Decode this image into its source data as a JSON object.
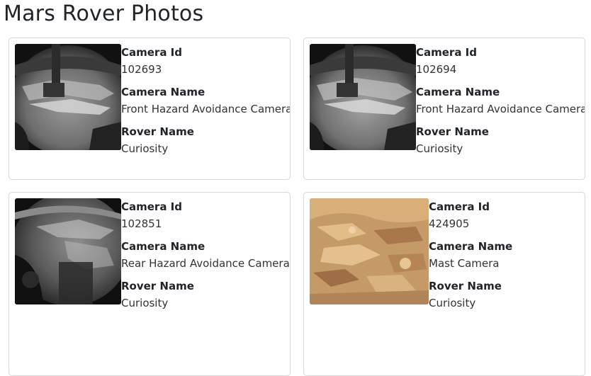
{
  "page": {
    "title": "Mars Rover Photos"
  },
  "labels": {
    "camera_id": "Camera Id",
    "camera_name": "Camera Name",
    "rover_name": "Rover Name"
  },
  "photos": [
    {
      "camera_id": "102693",
      "camera_name": "Front Hazard Avoidance Camera",
      "rover_name": "Curiosity",
      "image_kind": "grayscale-fisheye-hazcam"
    },
    {
      "camera_id": "102694",
      "camera_name": "Front Hazard Avoidance Camera",
      "rover_name": "Curiosity",
      "image_kind": "grayscale-fisheye-hazcam"
    },
    {
      "camera_id": "102851",
      "camera_name": "Rear Hazard Avoidance Camera",
      "rover_name": "Curiosity",
      "image_kind": "grayscale-fisheye-rear-hazcam"
    },
    {
      "camera_id": "424905",
      "camera_name": "Mast Camera",
      "rover_name": "Curiosity",
      "image_kind": "color-martian-rock-mastcam"
    }
  ]
}
